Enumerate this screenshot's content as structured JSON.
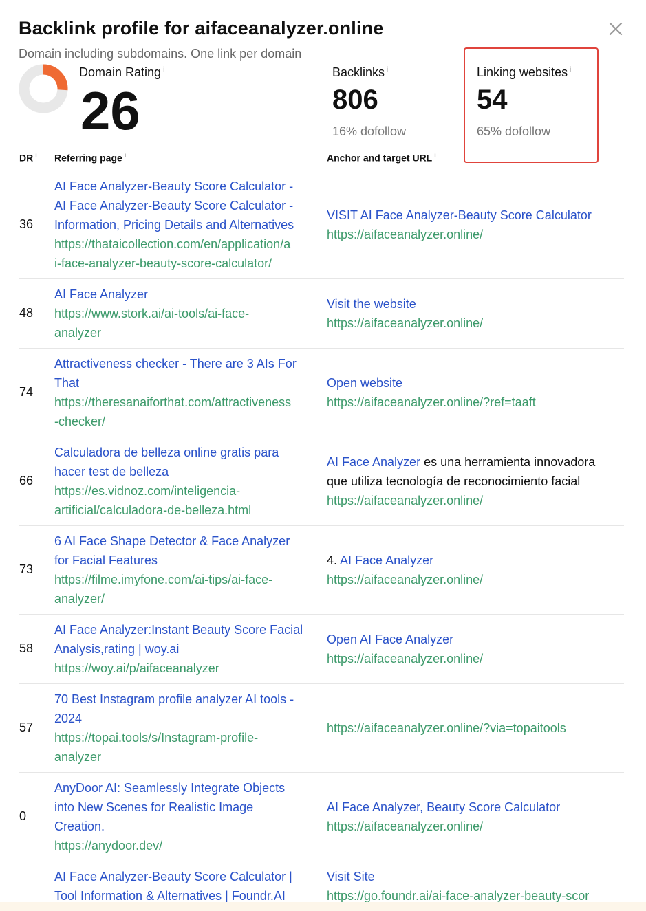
{
  "title": "Backlink profile for aifaceanalyzer.online",
  "subtitle": "Domain including subdomains. One link per domain",
  "metrics": {
    "domain_rating": {
      "label": "Domain Rating",
      "value": "26",
      "fraction": 0.26
    },
    "backlinks": {
      "label": "Backlinks",
      "value": "806",
      "sub": "16% dofollow"
    },
    "linking_websites": {
      "label": "Linking websites",
      "value": "54",
      "sub": "65% dofollow"
    }
  },
  "info_glyph": "i",
  "columns": {
    "dr": "DR",
    "referring": "Referring page",
    "anchor": "Anchor and target URL"
  },
  "rows": [
    {
      "dr": "36",
      "ref_title": [
        "AI Face Analyzer-Beauty Score Calculator -",
        "AI Face Analyzer-Beauty Score Calculator -",
        "Information, Pricing Details and Alternatives"
      ],
      "ref_url": [
        "https://thataicollection.com/en/application/a",
        "i-face-analyzer-beauty-score-calculator/"
      ],
      "anchor_prefix": "",
      "anchor_link": [
        "VISIT AI Face Analyzer-Beauty Score Calculator"
      ],
      "anchor_suffix": [],
      "target": [
        "https://aifaceanalyzer.online/"
      ]
    },
    {
      "dr": "48",
      "ref_title": [
        "AI Face Analyzer"
      ],
      "ref_url": [
        "https://www.stork.ai/ai-tools/ai-face-",
        "analyzer"
      ],
      "anchor_prefix": "",
      "anchor_link": [
        "Visit the website"
      ],
      "anchor_suffix": [],
      "target": [
        "https://aifaceanalyzer.online/"
      ]
    },
    {
      "dr": "74",
      "ref_title": [
        "Attractiveness checker - There are 3 AIs For",
        "That"
      ],
      "ref_url": [
        "https://theresanaiforthat.com/attractiveness",
        "-checker/"
      ],
      "anchor_prefix": "",
      "anchor_link": [
        "Open website"
      ],
      "anchor_suffix": [],
      "target": [
        "https://aifaceanalyzer.online/?ref=taaft"
      ]
    },
    {
      "dr": "66",
      "ref_title": [
        "Calculadora de belleza online gratis para",
        "hacer test de belleza"
      ],
      "ref_url": [
        "https://es.vidnoz.com/inteligencia-",
        "artificial/calculadora-de-belleza.html"
      ],
      "anchor_prefix": "",
      "anchor_link": [
        "AI Face Analyzer"
      ],
      "anchor_suffix": [
        " es una herramienta innovadora",
        "que utiliza tecnología de reconocimiento facial"
      ],
      "target": [
        "https://aifaceanalyzer.online/"
      ]
    },
    {
      "dr": "73",
      "ref_title": [
        "6 AI Face Shape Detector & Face Analyzer",
        "for Facial Features"
      ],
      "ref_url": [
        "https://filme.imyfone.com/ai-tips/ai-face-",
        "analyzer/"
      ],
      "anchor_prefix": "4. ",
      "anchor_link": [
        "AI Face Analyzer"
      ],
      "anchor_suffix": [],
      "target": [
        "https://aifaceanalyzer.online/"
      ]
    },
    {
      "dr": "58",
      "ref_title": [
        "AI Face Analyzer:Instant Beauty Score Facial",
        "Analysis,rating | woy.ai"
      ],
      "ref_url": [
        "https://woy.ai/p/aifaceanalyzer"
      ],
      "anchor_prefix": "",
      "anchor_link": [
        "Open AI Face Analyzer"
      ],
      "anchor_suffix": [],
      "target": [
        "https://aifaceanalyzer.online/"
      ]
    },
    {
      "dr": "57",
      "ref_title": [
        "70 Best Instagram profile analyzer AI tools -",
        "2024"
      ],
      "ref_url": [
        "https://topai.tools/s/Instagram-profile-",
        "analyzer"
      ],
      "anchor_prefix": "",
      "anchor_link": [],
      "anchor_suffix": [],
      "target": [
        "https://aifaceanalyzer.online/?via=topaitools"
      ]
    },
    {
      "dr": "0",
      "ref_title": [
        "AnyDoor AI: Seamlessly Integrate Objects",
        "into New Scenes for Realistic Image",
        "Creation."
      ],
      "ref_url": [
        "https://anydoor.dev/"
      ],
      "anchor_prefix": "",
      "anchor_link": [
        "AI Face Analyzer, Beauty Score Calculator"
      ],
      "anchor_suffix": [],
      "target": [
        "https://aifaceanalyzer.online/"
      ]
    },
    {
      "dr": "",
      "ref_title": [
        "AI Face Analyzer-Beauty Score Calculator |",
        "Tool Information & Alternatives | Foundr.AI"
      ],
      "ref_url": [],
      "anchor_prefix": "",
      "anchor_link": [
        "Visit Site"
      ],
      "anchor_suffix": [],
      "target": [
        "https://go.foundr.ai/ai-face-analyzer-beauty-scor"
      ]
    }
  ],
  "colors": {
    "link_blue": "#2a52c9",
    "url_green": "#3d9a6b",
    "donut_red": "#e84a3c",
    "donut_orange": "#f08a2c",
    "donut_track": "#e8e8e8",
    "highlight": "#e0443c"
  }
}
